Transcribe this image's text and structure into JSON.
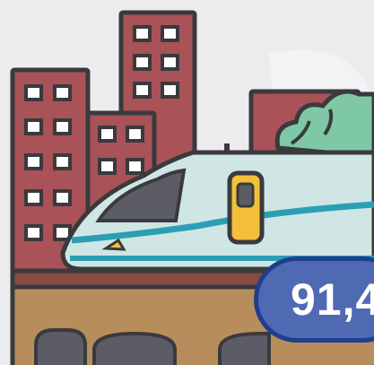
{
  "illustration": {
    "subject": "train-city-illustration"
  },
  "badge": {
    "value": "91,4"
  },
  "colors": {
    "background": "#ececee",
    "building": "#a95257",
    "building_dark": "#8d3e44",
    "window": "#ffffff",
    "outline": "#3a3a3e",
    "train_body": "#cfe6e4",
    "train_stripe": "#2a9fb4",
    "train_window": "#5c5c66",
    "train_door": "#f4bf3a",
    "tree": "#7fc8a6",
    "bridge": "#b88d5c",
    "bridge_arch": "#5c5c66",
    "badge_fill": "#5069b3",
    "badge_border": "#1f3f8e"
  }
}
